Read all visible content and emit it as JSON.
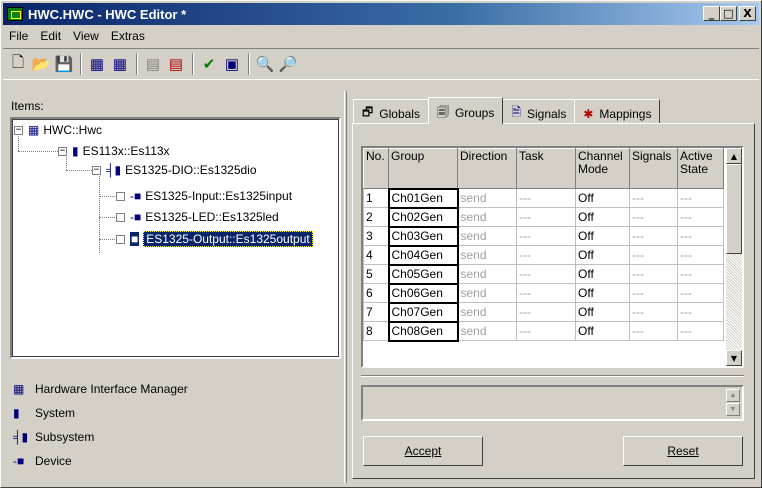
{
  "window": {
    "title": "HWC.HWC - HWC Editor  *",
    "minimize": "_",
    "maximize": "□",
    "close": "X"
  },
  "menu": [
    "File",
    "Edit",
    "View",
    "Extras"
  ],
  "items_label": "Items:",
  "tree": [
    {
      "label": "HWC::Hwc",
      "icon": "hardware-manager-icon"
    },
    {
      "label": "ES113x::Es113x",
      "icon": "system-icon"
    },
    {
      "label": "ES1325-DIO::Es1325dio",
      "icon": "subsystem-icon"
    },
    {
      "label": "ES1325-Input::Es1325input",
      "icon": "device-icon"
    },
    {
      "label": "ES1325-LED::Es1325led",
      "icon": "device-icon"
    },
    {
      "label": "ES1325-Output::Es1325output",
      "icon": "device-icon",
      "selected": true
    }
  ],
  "legend": [
    {
      "label": "Hardware Interface Manager",
      "icon": "hardware-manager-icon"
    },
    {
      "label": "System",
      "icon": "system-icon"
    },
    {
      "label": "Subsystem",
      "icon": "subsystem-icon"
    },
    {
      "label": "Device",
      "icon": "device-icon"
    }
  ],
  "tabs": [
    {
      "label": "Globals",
      "icon": "globals-icon"
    },
    {
      "label": "Groups",
      "icon": "groups-icon",
      "active": true
    },
    {
      "label": "Signals",
      "icon": "signals-icon"
    },
    {
      "label": "Mappings",
      "icon": "mappings-icon"
    }
  ],
  "table": {
    "headers": [
      "No.",
      "Group",
      "Direction",
      "Task",
      "Channel Mode",
      "Signals",
      "Active State"
    ],
    "rows": [
      [
        "1",
        "Ch01Gen",
        "send",
        "---",
        "Off",
        "---",
        "---"
      ],
      [
        "2",
        "Ch02Gen",
        "send",
        "---",
        "Off",
        "---",
        "---"
      ],
      [
        "3",
        "Ch03Gen",
        "send",
        "---",
        "Off",
        "---",
        "---"
      ],
      [
        "4",
        "Ch04Gen",
        "send",
        "---",
        "Off",
        "---",
        "---"
      ],
      [
        "5",
        "Ch05Gen",
        "send",
        "---",
        "Off",
        "---",
        "---"
      ],
      [
        "6",
        "Ch06Gen",
        "send",
        "---",
        "Off",
        "---",
        "---"
      ],
      [
        "7",
        "Ch07Gen",
        "send",
        "---",
        "Off",
        "---",
        "---"
      ],
      [
        "8",
        "Ch08Gen",
        "send",
        "---",
        "Off",
        "---",
        "---"
      ]
    ]
  },
  "buttons": {
    "accept": "Accept",
    "reset": "Reset"
  }
}
